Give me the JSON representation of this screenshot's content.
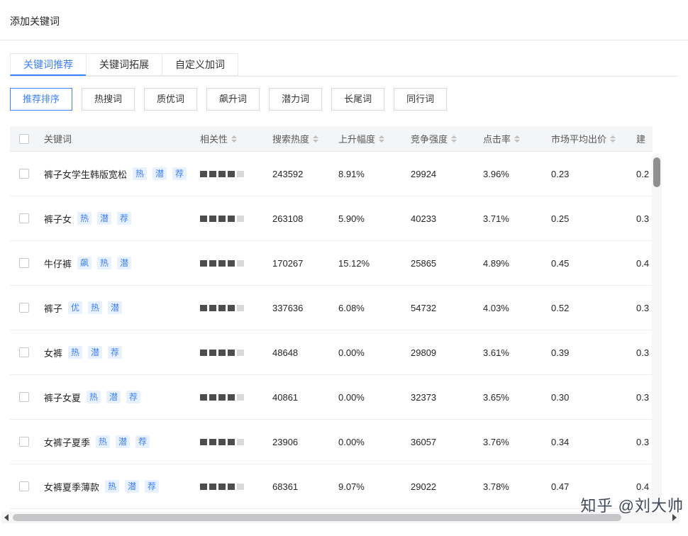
{
  "page": {
    "title": "添加关键词"
  },
  "colors": {
    "accent": "#3d7fff",
    "badge_bg": "#e8f1ff",
    "header_bg": "#f4f5f7"
  },
  "tabs": [
    {
      "label": "关键词推荐",
      "active": true
    },
    {
      "label": "关键词拓展",
      "active": false
    },
    {
      "label": "自定义加词",
      "active": false
    }
  ],
  "filters": [
    {
      "label": "推荐排序",
      "active": true
    },
    {
      "label": "热搜词",
      "active": false
    },
    {
      "label": "质优词",
      "active": false
    },
    {
      "label": "飙升词",
      "active": false
    },
    {
      "label": "潜力词",
      "active": false
    },
    {
      "label": "长尾词",
      "active": false
    },
    {
      "label": "同行词",
      "active": false
    }
  ],
  "table": {
    "columns": [
      "关键词",
      "相关性",
      "搜索热度",
      "上升幅度",
      "竞争强度",
      "点击率",
      "市场平均出价",
      "建"
    ],
    "sortable": [
      false,
      true,
      true,
      true,
      true,
      true,
      true,
      false
    ],
    "relevance_max": 5,
    "rows": [
      {
        "keyword": "裤子女学生韩版宽松",
        "tags": [
          "热",
          "潜",
          "荐"
        ],
        "relevance": 4,
        "search_heat": "243592",
        "rise": "8.91%",
        "competition": "29924",
        "ctr": "3.96%",
        "avg_bid": "0.23",
        "suggest_bid": "0.2"
      },
      {
        "keyword": "裤子女",
        "tags": [
          "热",
          "潜",
          "荐"
        ],
        "relevance": 4,
        "search_heat": "263108",
        "rise": "5.90%",
        "competition": "40233",
        "ctr": "3.71%",
        "avg_bid": "0.25",
        "suggest_bid": "0.3"
      },
      {
        "keyword": "牛仔裤",
        "tags": [
          "飙",
          "热",
          "潜"
        ],
        "relevance": 4,
        "search_heat": "170267",
        "rise": "15.12%",
        "competition": "25865",
        "ctr": "4.89%",
        "avg_bid": "0.45",
        "suggest_bid": "0.4"
      },
      {
        "keyword": "裤子",
        "tags": [
          "优",
          "热",
          "潜"
        ],
        "relevance": 4,
        "search_heat": "337636",
        "rise": "6.08%",
        "competition": "54732",
        "ctr": "4.03%",
        "avg_bid": "0.52",
        "suggest_bid": "0.3"
      },
      {
        "keyword": "女裤",
        "tags": [
          "热",
          "潜",
          "荐"
        ],
        "relevance": 4,
        "search_heat": "48648",
        "rise": "0.00%",
        "competition": "29809",
        "ctr": "3.61%",
        "avg_bid": "0.39",
        "suggest_bid": "0.3"
      },
      {
        "keyword": "裤子女夏",
        "tags": [
          "热",
          "潜",
          "荐"
        ],
        "relevance": 4,
        "search_heat": "40861",
        "rise": "0.00%",
        "competition": "32373",
        "ctr": "3.65%",
        "avg_bid": "0.30",
        "suggest_bid": "0.3"
      },
      {
        "keyword": "女裤子夏季",
        "tags": [
          "热",
          "潜",
          "荐"
        ],
        "relevance": 4,
        "search_heat": "23906",
        "rise": "0.00%",
        "competition": "36057",
        "ctr": "3.76%",
        "avg_bid": "0.34",
        "suggest_bid": "0.3"
      },
      {
        "keyword": "女裤夏季薄款",
        "tags": [
          "热",
          "潜",
          "荐"
        ],
        "relevance": 4,
        "search_heat": "68361",
        "rise": "9.07%",
        "competition": "29022",
        "ctr": "3.78%",
        "avg_bid": "0.47",
        "suggest_bid": "0.4"
      }
    ]
  },
  "watermark": {
    "text": "知乎 @刘大帅"
  }
}
